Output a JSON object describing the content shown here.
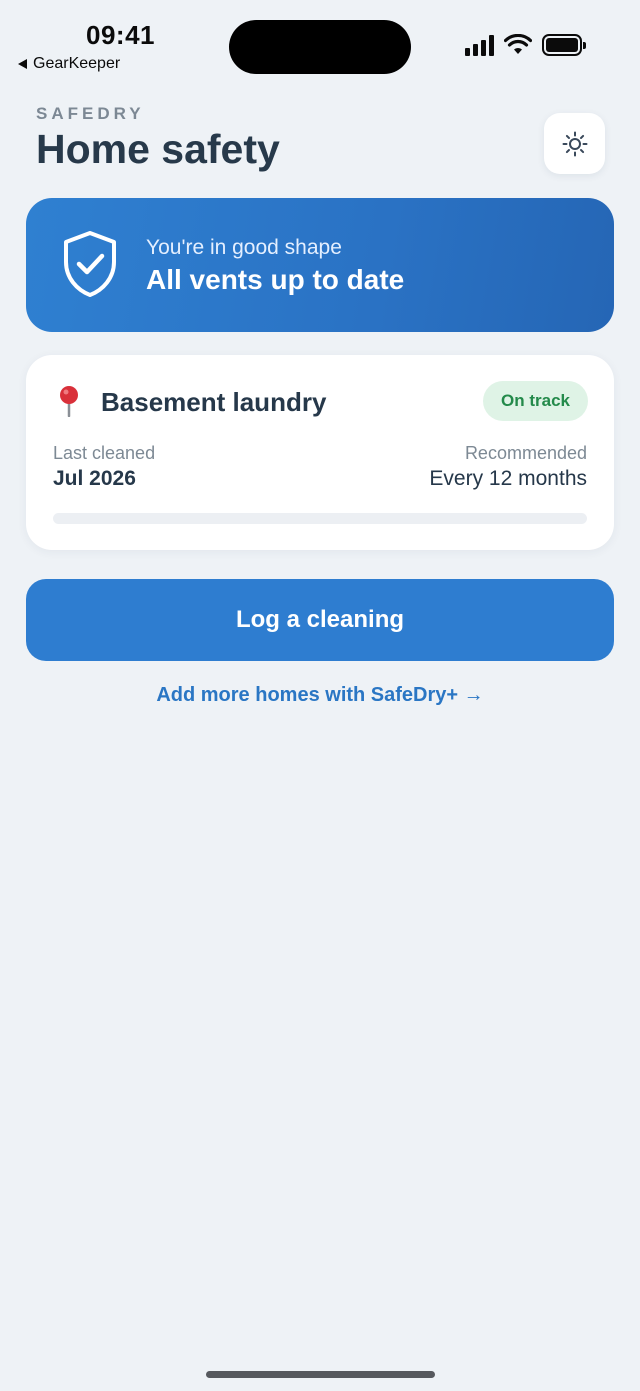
{
  "status_bar": {
    "time": "09:41",
    "back_app": "GearKeeper"
  },
  "header": {
    "brand": "SAFEDRY",
    "title": "Home safety",
    "theme_icon": "sun-icon"
  },
  "banner": {
    "icon": "shield-check-icon",
    "subtitle": "You're in good shape",
    "headline": "All vents up to date"
  },
  "location_card": {
    "icon": "pushpin-icon",
    "name": "Basement laundry",
    "status_badge": "On track",
    "last_cleaned_label": "Last cleaned",
    "last_cleaned_value": "Jul 2026",
    "recommended_label": "Recommended",
    "recommended_value": "Every 12 months",
    "progress_fraction": 0
  },
  "actions": {
    "primary_label": "Log a cleaning",
    "upsell_label": "Add more homes with SafeDry+ →"
  },
  "colors": {
    "accent": "#2e7dd0",
    "badge_bg": "#dff3e6",
    "badge_text": "#248a4b",
    "background": "#eef2f6"
  }
}
